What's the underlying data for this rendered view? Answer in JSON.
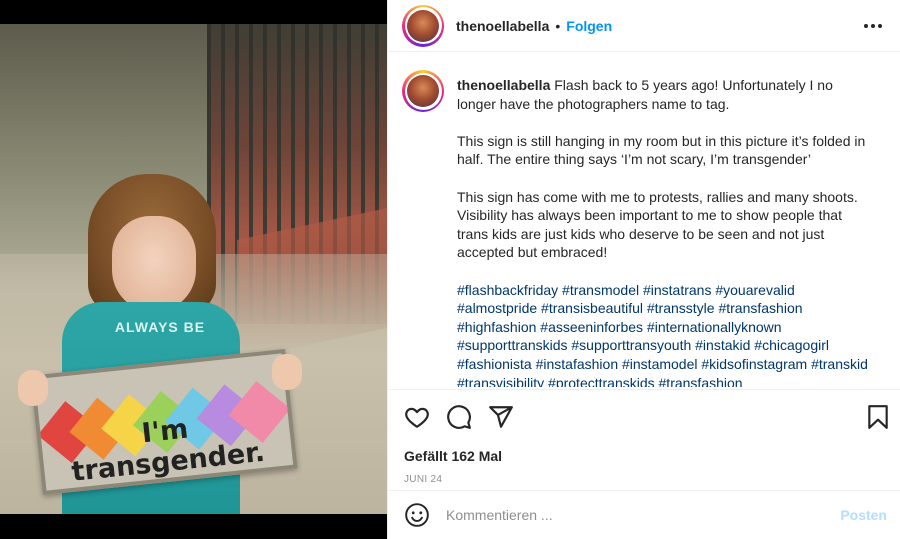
{
  "post": {
    "username": "thenoellabella",
    "follow_label": "Folgen",
    "header_dot": "•",
    "caption": {
      "username": "thenoellabella",
      "paragraphs": [
        "Flash back to 5 years ago! Unfortunately I no longer have the photographers name to tag.",
        "This sign is still hanging in my room but in this picture it’s folded in half. The entire thing says ‘I’m not scary, I’m transgender’",
        "This sign has come with me to protests, rallies and many shoots. Visibility has always been important to me to show people that trans kids are just kids who deserve to be seen and not just accepted but embraced!"
      ],
      "hashtags": "#flashbackfriday #transmodel #instatrans #youarevalid #almostpride #transisbeautiful #transstyle #transfashion #highfashion #asseeninforbes #internationallyknown #supporttranskids #supporttransyouth #instakid #chicagogirl #fashionista #instafashion #instamodel #kidsofinstagram #transkid #transvisibility #protecttranskids #transfashion"
    },
    "likes": "Gefällt 162 Mal",
    "date": "JUNI 24",
    "comment": {
      "placeholder": "Kommentieren ...",
      "value": "",
      "post_label": "Posten"
    },
    "photo": {
      "shirt_text": "ALWAYS BE",
      "sign_text": "I'm transgender."
    }
  },
  "icons": [
    "more-icon",
    "heart-icon",
    "comment-icon",
    "share-icon",
    "bookmark-icon",
    "emoji-icon"
  ],
  "colors": {
    "follow": "#0095f6",
    "post_button_disabled": "#b2dffc",
    "hashtag": "#00376b",
    "border": "#efefef",
    "muted": "#8e8e8e"
  }
}
